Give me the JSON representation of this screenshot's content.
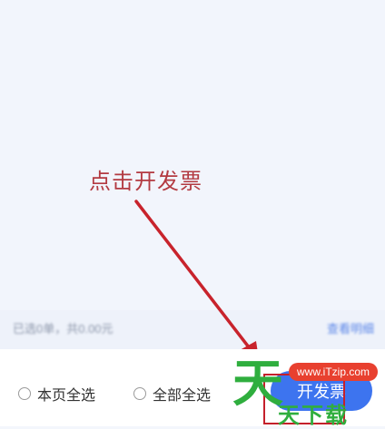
{
  "annotation": {
    "text": "点击开发票"
  },
  "summary": {
    "left_text": "已选0单，共0.00元",
    "right_text": "查看明细"
  },
  "bottom_bar": {
    "select_page_label": "本页全选",
    "select_all_label": "全部全选",
    "issue_button_label": "开发票"
  },
  "watermark": {
    "logo": "天",
    "badge": "www.iTzip.com",
    "sub": "天下载"
  },
  "colors": {
    "annotation": "#b33a41",
    "arrow": "#c8232c",
    "primary_button": "#3d74ef",
    "highlight_box": "#c4202b",
    "watermark_green": "#2fae3e",
    "watermark_badge": "#e8402f"
  },
  "icons": {
    "radio": "radio-unchecked-icon"
  }
}
